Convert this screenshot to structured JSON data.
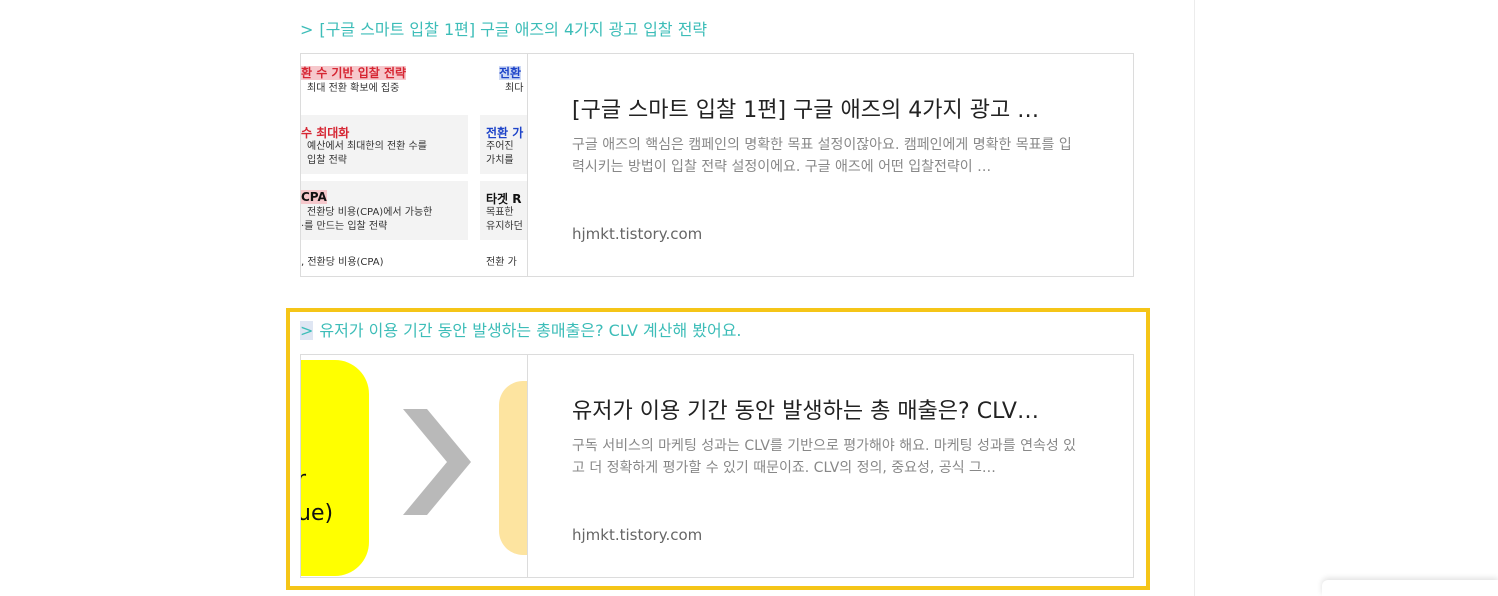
{
  "links": [
    {
      "title_prefix": ">",
      "title": "[구글 스마트 입찰 1편] 구글 애즈의 4가지 광고 입찰 전략",
      "card": {
        "title": "[구글 스마트 입찰 1편] 구글 애즈의 4가지 광고 …",
        "description": "구글 애즈의 핵심은 캠페인의 명확한 목표 설정이잖아요. 캠페인에게 명확한 목표를 입력시키는 방법이 입찰 전략 설정이에요. 구글 애즈에 어떤 입찰전략이 …",
        "domain": "hjmkt.tistory.com"
      },
      "thumbnail": {
        "left_col": [
          {
            "heading": "환 수 기반 입찰 전략",
            "lines": [
              "최대 전환 확보에 집중"
            ]
          },
          {
            "heading": "수 최대화",
            "lines": [
              "예산에서 최대한의 전환 수를",
              "입찰 전략"
            ]
          },
          {
            "heading": "CPA",
            "lines": [
              "전환당 비용(CPA)에서 가능한",
              "·를 만드는 입찰 전략"
            ]
          }
        ],
        "right_col": [
          {
            "heading": "전환",
            "lines": [
              "최다"
            ]
          },
          {
            "heading": "전환 가",
            "lines": [
              "주어진",
              "가치를"
            ]
          },
          {
            "heading": "타겟 R",
            "lines": [
              "목표한",
              "유지하던"
            ]
          }
        ],
        "footer_left": ", 전환당 비용(CPA)",
        "footer_right": "전환 가"
      }
    },
    {
      "title_prefix": ">",
      "title": "유저가 이용 기간 동안 발생하는 총매출은? CLV 계산해 봤어요.",
      "card": {
        "title": "유저가 이용 기간 동안 발생하는 총 매출은? CLV…",
        "description": "구독 서비스의 마케팅 성과는 CLV를 기반으로 평가해야 해요. 마케팅 성과를 연속성 있고 더 정확하게 평가할 수 있기 때문이죠. CLV의 정의, 중요성, 공식 그…",
        "domain": "hjmkt.tistory.com"
      },
      "thumbnail": {
        "text_line1": "r",
        "text_line2": "ue)"
      }
    }
  ],
  "colors": {
    "link_title": "#3dbdb8",
    "highlight_frame": "#f5c518"
  },
  "icons": {
    "chevron": "chevron-right-icon"
  }
}
